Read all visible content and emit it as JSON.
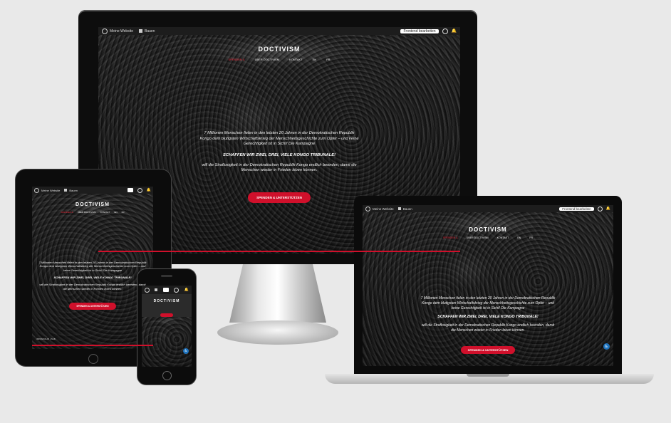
{
  "site": {
    "admin_site_name": "Meine Website",
    "admin_new": "Bauen",
    "admin_button": "Frontend bearbeiten",
    "logo": "DOCTIVISM",
    "nav": [
      "SPENDEN &",
      "ÜBER DOCTIVISM",
      "KONTAKT",
      "EN",
      "FR"
    ],
    "intro": "7 Millionen Menschen fielen in den letzten 20 Jahren in der Demokratischen Republik Kongo dem blutigsten Wirtschaftskrieg der Menschheitsgeschichte zum Opfer – und keine Gerechtigkeit ist in Sicht! Die Kampagne",
    "headline": "SCHAFFEN WIR ZWEI, DREI, VIELE KONGO TRIBUNALE!",
    "goal": "will die Straflosigkeit in der Demokratischen Republik Kongo endlich beenden, damit die Menschen wieder in Frieden leben können.",
    "cta": "SPENDEN & UNTERSTÜTZEN",
    "tablet_footer": "IMPRESSUM  |  AGB"
  },
  "colors": {
    "accent": "#d0102b",
    "admin_bar": "#1d1d1d",
    "background": "#e9e9e9",
    "a11y": "#1e73be"
  },
  "icons": {
    "wp_logo": "wordpress-icon",
    "new": "plus-icon",
    "notifications": "bell-icon",
    "a11y": "accessibility-icon"
  }
}
